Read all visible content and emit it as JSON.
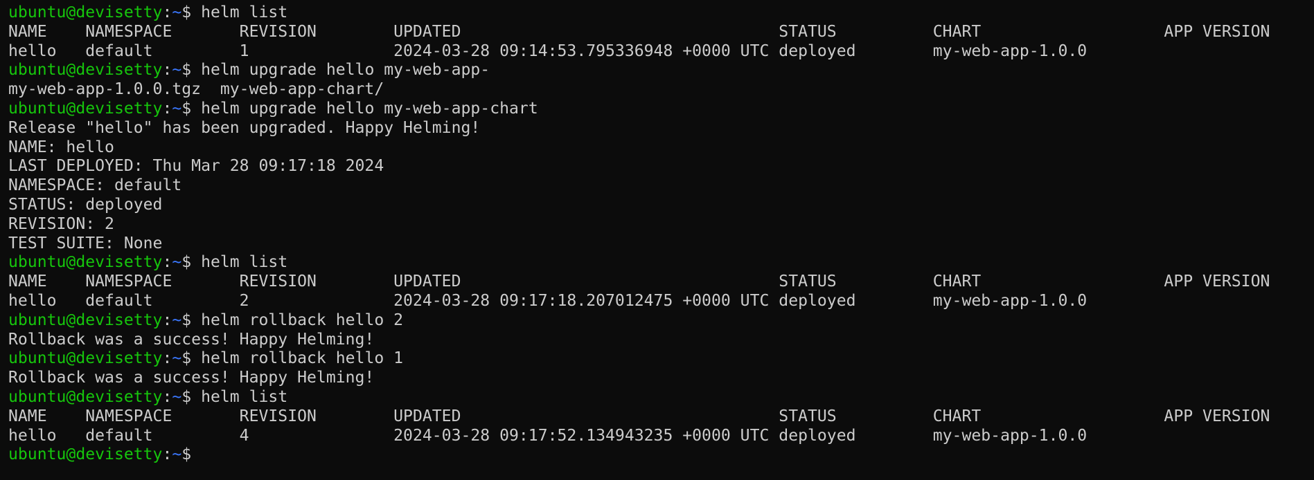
{
  "terminal": {
    "colors": {
      "background": "#0c0c0c",
      "foreground": "#cccccc",
      "prompt_user": "#16c60c",
      "prompt_path": "#3b78ff"
    },
    "prompt": {
      "user_host": "ubuntu@devisetty",
      "colon": ":",
      "path": "~",
      "symbol": "$ "
    },
    "lines": [
      {
        "type": "prompt",
        "cmd": "helm list"
      },
      {
        "type": "output",
        "text": "NAME    NAMESPACE       REVISION        UPDATED                                 STATUS          CHART                   APP VERSION"
      },
      {
        "type": "output",
        "text": "hello   default         1               2024-03-28 09:14:53.795336948 +0000 UTC deployed        my-web-app-1.0.0"
      },
      {
        "type": "prompt",
        "cmd": "helm upgrade hello my-web-app-"
      },
      {
        "type": "output",
        "text": "my-web-app-1.0.0.tgz  my-web-app-chart/"
      },
      {
        "type": "prompt",
        "cmd": "helm upgrade hello my-web-app-chart"
      },
      {
        "type": "output",
        "text": "Release \"hello\" has been upgraded. Happy Helming!"
      },
      {
        "type": "output",
        "text": "NAME: hello"
      },
      {
        "type": "output",
        "text": "LAST DEPLOYED: Thu Mar 28 09:17:18 2024"
      },
      {
        "type": "output",
        "text": "NAMESPACE: default"
      },
      {
        "type": "output",
        "text": "STATUS: deployed"
      },
      {
        "type": "output",
        "text": "REVISION: 2"
      },
      {
        "type": "output",
        "text": "TEST SUITE: None"
      },
      {
        "type": "prompt",
        "cmd": "helm list"
      },
      {
        "type": "output",
        "text": "NAME    NAMESPACE       REVISION        UPDATED                                 STATUS          CHART                   APP VERSION"
      },
      {
        "type": "output",
        "text": "hello   default         2               2024-03-28 09:17:18.207012475 +0000 UTC deployed        my-web-app-1.0.0"
      },
      {
        "type": "prompt",
        "cmd": "helm rollback hello 2"
      },
      {
        "type": "output",
        "text": "Rollback was a success! Happy Helming!"
      },
      {
        "type": "prompt",
        "cmd": "helm rollback hello 1"
      },
      {
        "type": "output",
        "text": "Rollback was a success! Happy Helming!"
      },
      {
        "type": "prompt",
        "cmd": "helm list"
      },
      {
        "type": "output",
        "text": "NAME    NAMESPACE       REVISION        UPDATED                                 STATUS          CHART                   APP VERSION"
      },
      {
        "type": "output",
        "text": "hello   default         4               2024-03-28 09:17:52.134943235 +0000 UTC deployed        my-web-app-1.0.0"
      },
      {
        "type": "prompt",
        "cmd": ""
      }
    ]
  }
}
